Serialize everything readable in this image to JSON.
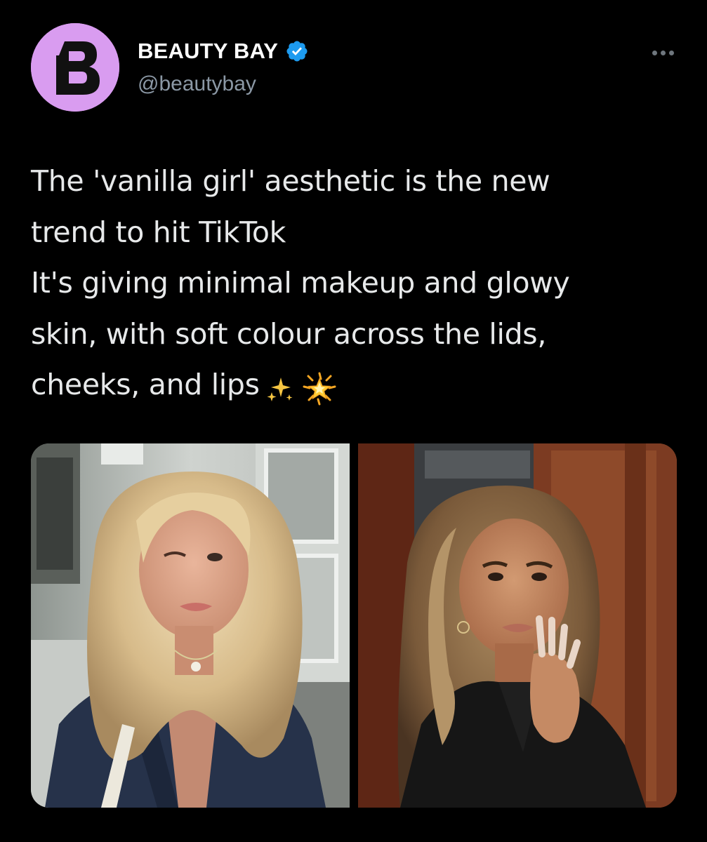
{
  "account": {
    "display_name": "BEAUTY BAY",
    "handle": "@beautybay",
    "verified": true,
    "avatar_letter": "B",
    "avatar_color": "#d99cf0"
  },
  "tweet": {
    "text_lines": [
      "The 'vanilla girl' aesthetic is the new",
      "trend to hit TikTok",
      "It's giving minimal makeup and glowy",
      "skin, with soft colour across the lids,",
      "cheeks, and lips"
    ],
    "emojis": [
      "sparkles-icon",
      "glowing-star-icon"
    ]
  },
  "media": {
    "photos": [
      "photo-blonde-selfie",
      "photo-brunette-portrait"
    ]
  },
  "colors": {
    "background": "#000000",
    "text": "#e7e9ea",
    "secondary_text": "#8b98a5",
    "verified_blue": "#1d9bf0"
  }
}
